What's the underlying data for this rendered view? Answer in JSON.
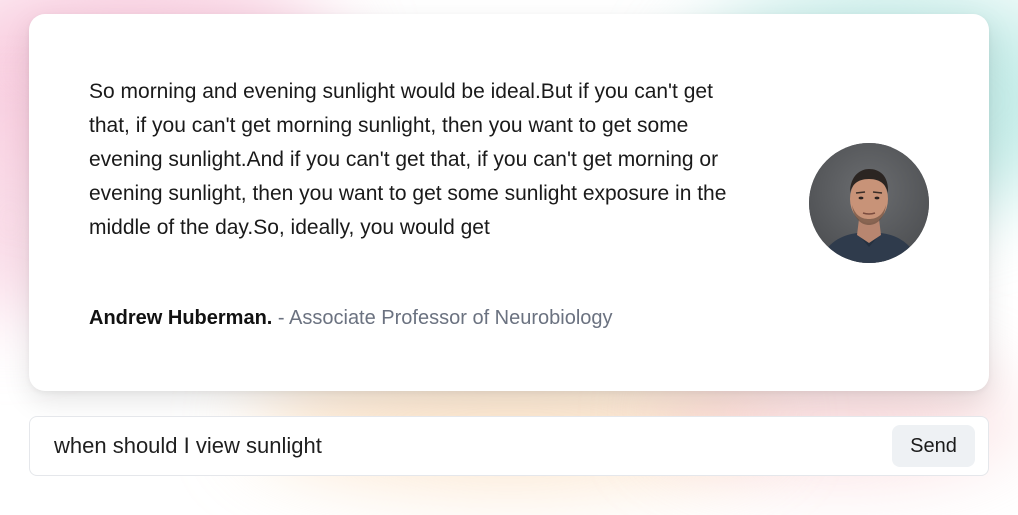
{
  "quote": {
    "text": "So morning and evening sunlight would be ideal.But if you can't get that, if you can't get morning sunlight, then you want to get some evening sunlight.And if you can't get that, if you can't get morning or evening sunlight, then you want to get some sunlight exposure in the middle of the day.So, ideally, you would get",
    "author_name": "Andrew Huberman.",
    "separator": " - ",
    "author_title": "Associate Professor of Neurobiology",
    "avatar_icon": "person-portrait"
  },
  "search": {
    "value": "when should I view sunlight",
    "send_label": "Send"
  },
  "colors": {
    "card_background": "#ffffff",
    "text_primary": "#1a1a1a",
    "text_muted": "#6b7280",
    "send_button_bg": "#eef1f4"
  }
}
